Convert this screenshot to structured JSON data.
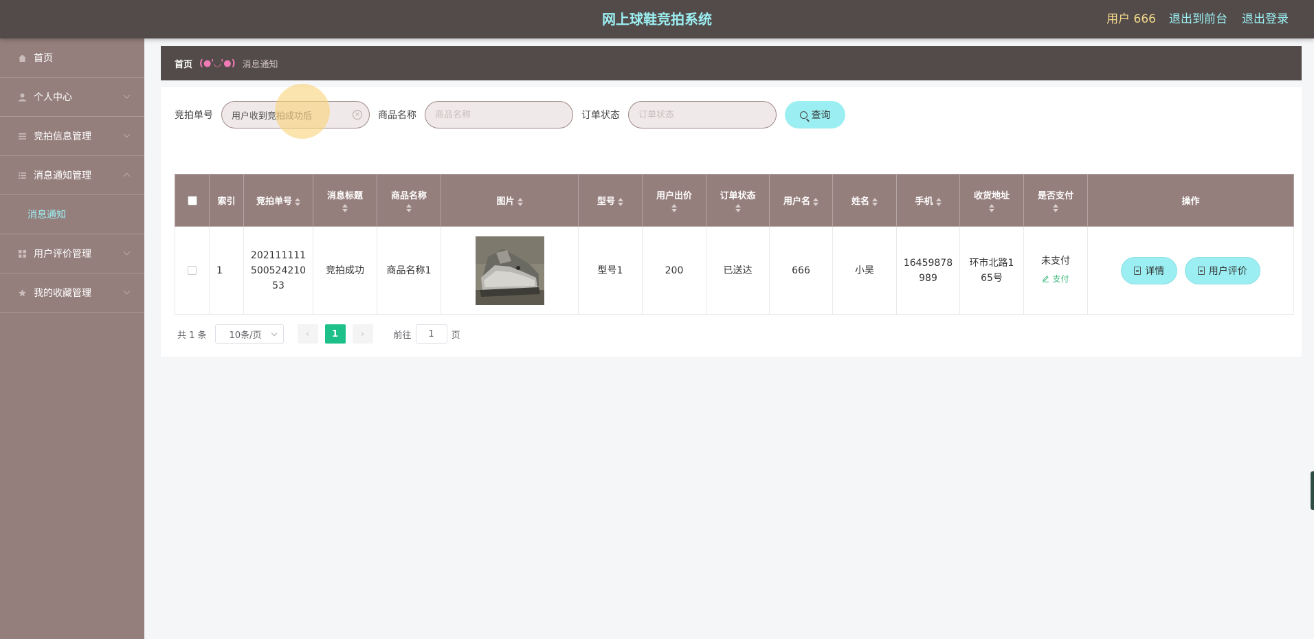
{
  "header": {
    "title": "网上球鞋竞拍系统",
    "user": "用户 666",
    "front_link": "退出到前台",
    "logout_link": "退出登录"
  },
  "sidebar": {
    "items": [
      {
        "label": "首页",
        "icon": "home-icon"
      },
      {
        "label": "个人中心",
        "icon": "user-icon"
      },
      {
        "label": "竞拍信息管理",
        "icon": "list-icon"
      },
      {
        "label": "消息通知管理",
        "icon": "menu-icon"
      },
      {
        "label": "用户评价管理",
        "icon": "grid-icon"
      },
      {
        "label": "我的收藏管理",
        "icon": "star-icon"
      }
    ],
    "submenu": "消息通知"
  },
  "breadcrumb": {
    "home": "首页",
    "separator": "(●'◡'●)",
    "current": "消息通知"
  },
  "search": {
    "field1_label": "竞拍单号",
    "field1_value": "用户收到竞拍成功后",
    "field2_label": "商品名称",
    "field2_placeholder": "商品名称",
    "field3_label": "订单状态",
    "field3_placeholder": "订单状态",
    "button": "查询"
  },
  "table": {
    "headers": {
      "index": "索引",
      "order_no": "竞拍单号",
      "msg_title": "消息标题",
      "product": "商品名称",
      "image": "图片",
      "model": "型号",
      "bid": "用户出价",
      "status": "订单状态",
      "username": "用户名",
      "name": "姓名",
      "phone": "手机",
      "address": "收货地址",
      "paid": "是否支付",
      "actions": "操作"
    },
    "rows": [
      {
        "index": "1",
        "order_no": "2021111115005242105 3",
        "order_no_l1": "202111111",
        "order_no_l2": "500524210",
        "order_no_l3": "53",
        "msg_title": "竞拍成功",
        "product": "商品名称1",
        "model": "型号1",
        "bid": "200",
        "status": "已送达",
        "username": "666",
        "name": "小吴",
        "phone_l1": "16459878",
        "phone_l2": "989",
        "address_l1": "环市北路1",
        "address_l2": "65号",
        "paid": "未支付",
        "pay_action": "支付",
        "detail_btn": "详情",
        "review_btn": "用户评价"
      }
    ]
  },
  "pagination": {
    "total": "共 1 条",
    "page_size": "10条/页",
    "current_page": "1",
    "goto_label": "前往",
    "goto_value": "1",
    "page_suffix": "页"
  }
}
